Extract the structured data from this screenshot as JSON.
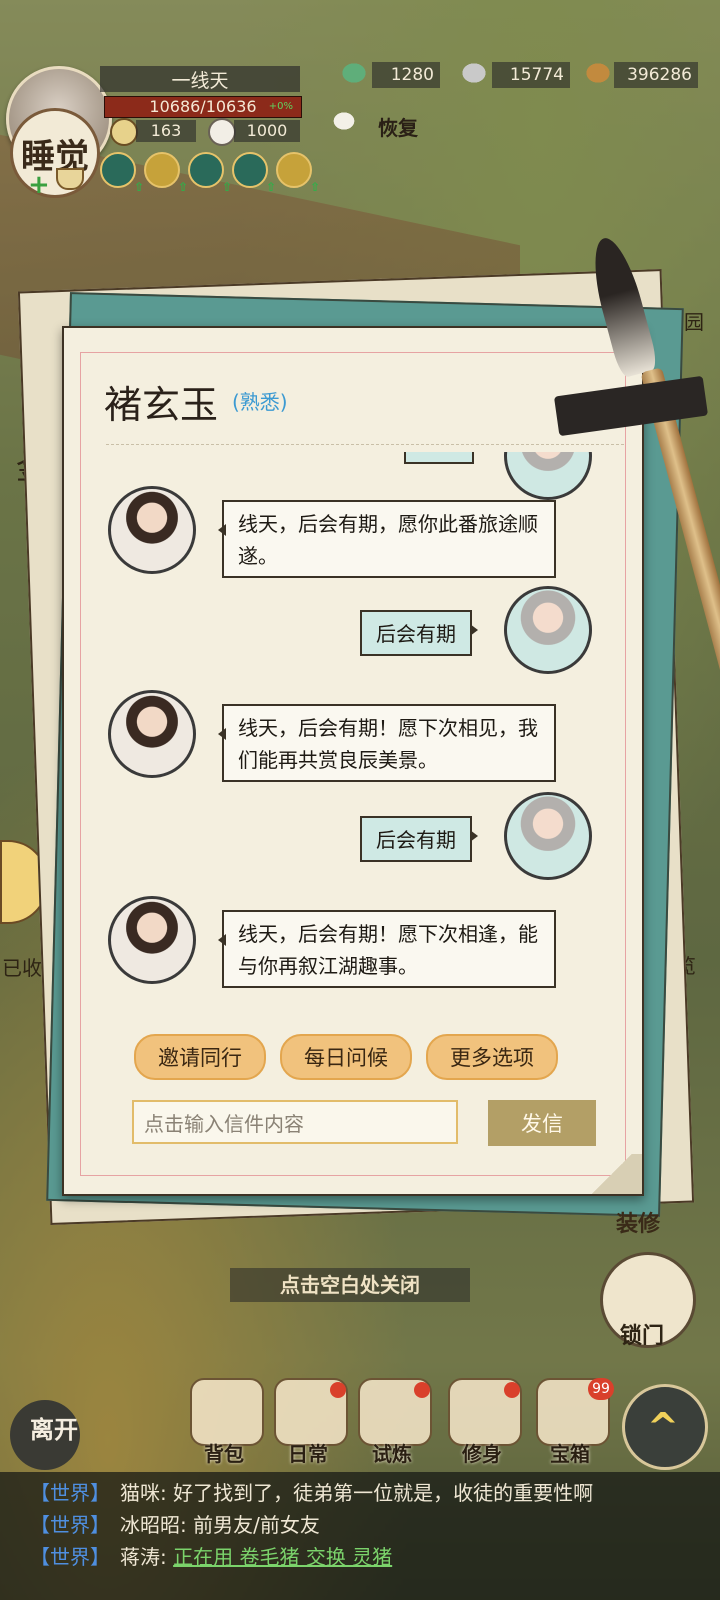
{
  "hud": {
    "player_name": "一线天",
    "hp_text": "10686/10636",
    "hp_pct": "+0%",
    "stat1": "163",
    "stat2": "1000",
    "sleep_label": "睡觉",
    "recover_label": "恢复",
    "currencies": [
      "1280",
      "15774",
      "396286"
    ]
  },
  "dialog": {
    "contact_name": "褚玄玉",
    "relation": "(熟悉)",
    "messages": [
      {
        "side": "left",
        "text": "线天，后会有期，愿你此番旅途顺遂。"
      },
      {
        "side": "right",
        "text": "后会有期"
      },
      {
        "side": "left",
        "text": "线天，后会有期！愿下次相见，我们能再共赏良辰美景。"
      },
      {
        "side": "right",
        "text": "后会有期"
      },
      {
        "side": "left",
        "text": "线天，后会有期！愿下次相逢，能与你再叙江湖趣事。"
      }
    ],
    "options": [
      "邀请同行",
      "每日问候",
      "更多选项"
    ],
    "input_placeholder": "点击输入信件内容",
    "send_label": "发信"
  },
  "side": {
    "garden_label": "园",
    "overview_label": "览",
    "collected_label": "已收集",
    "gold_label": "金",
    "decorate_label": "装修",
    "lock_label": "锁门",
    "close_hint": "点击空白处关闭"
  },
  "bottom_nav": {
    "leave_label": "离开",
    "items": [
      {
        "label": "背包",
        "dot": false
      },
      {
        "label": "日常",
        "dot": true
      },
      {
        "label": "试炼",
        "dot": true
      },
      {
        "label": "修身",
        "dot": true
      },
      {
        "label": "宝箱",
        "badge": "99"
      }
    ]
  },
  "world_chat": [
    {
      "tag": "【世界】",
      "user": "猫咪:",
      "text": "好了找到了，徒弟第一位就是，收徒的重要性啊"
    },
    {
      "tag": "【世界】",
      "user": "冰昭昭:",
      "text": "前男友/前女友"
    },
    {
      "tag": "【世界】",
      "user": "蒋涛:",
      "text": "",
      "link": "正在用 卷毛猪 交换 灵猪"
    }
  ]
}
